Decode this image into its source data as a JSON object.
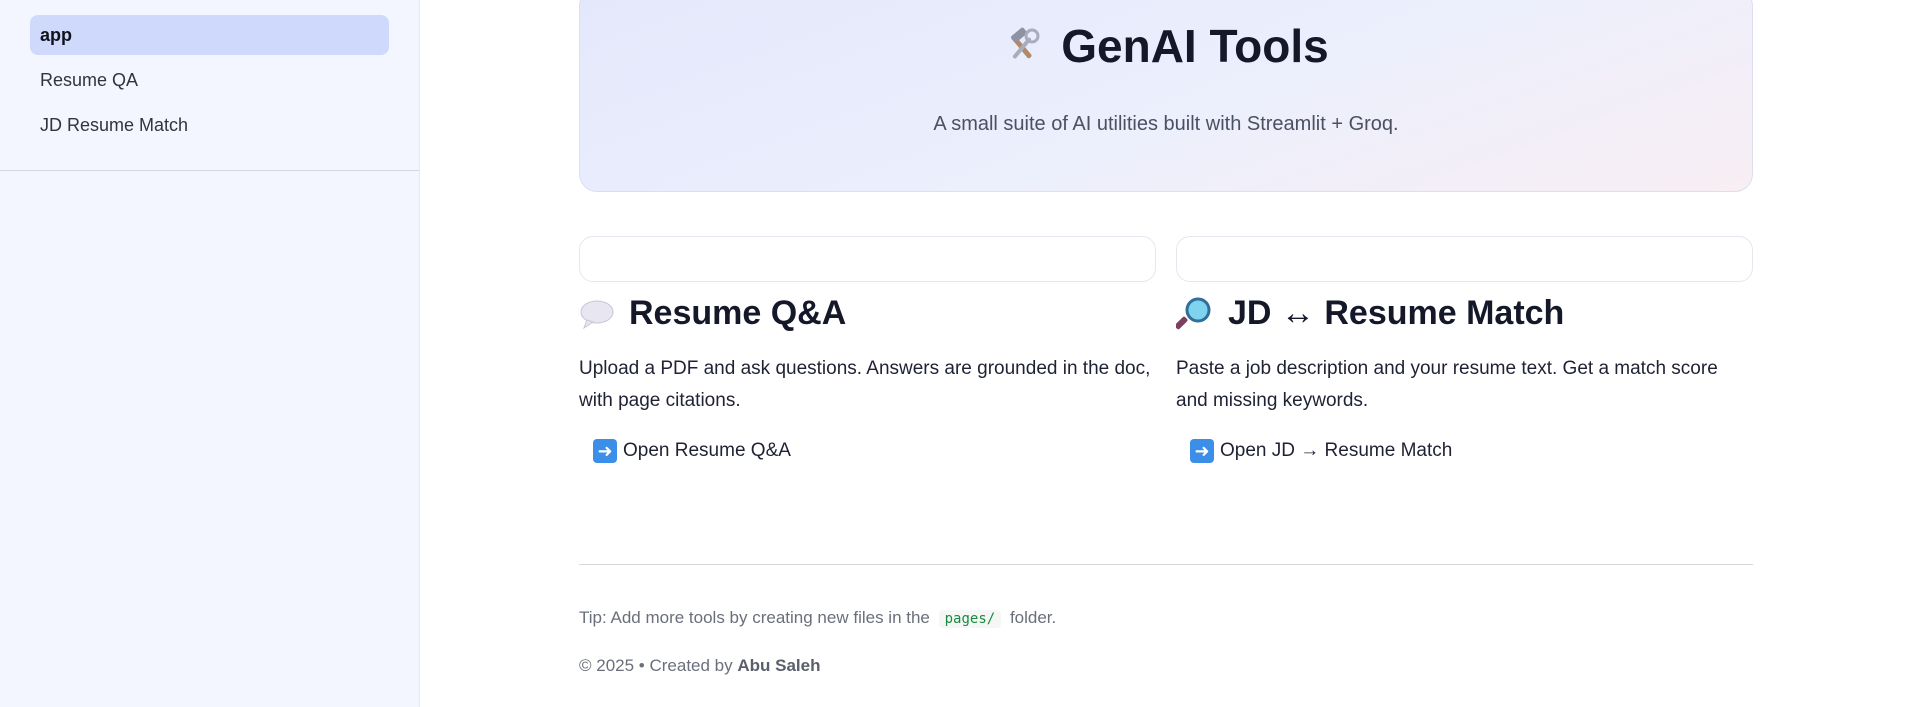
{
  "sidebar": {
    "items": [
      {
        "label": "app",
        "active": true
      },
      {
        "label": "Resume QA",
        "active": false
      },
      {
        "label": "JD Resume Match",
        "active": false
      }
    ]
  },
  "hero": {
    "icon": "hammer-wrench-icon",
    "title": "GenAI Tools",
    "subtitle": "A small suite of AI utilities built with Streamlit + Groq."
  },
  "cards": [
    {
      "icon": "speech-bubble-icon",
      "title": "Resume Q&A",
      "description": "Upload a PDF and ask questions. Answers are grounded in the doc, with page citations.",
      "link_icon": "right-arrow-icon",
      "link_label": "Open Resume Q&A"
    },
    {
      "icon": "magnifying-glass-icon",
      "title": "JD ↔ Resume Match",
      "description": "Paste a job description and your resume text. Get a match score and missing keywords.",
      "link_icon": "right-arrow-icon",
      "link_label": "Open JD → Resume Match"
    }
  ],
  "tip": {
    "before": "Tip: Add more tools by creating new files in the",
    "code": "pages/",
    "after": "folder."
  },
  "footer": {
    "prefix": "© 2025 • Created by",
    "author": "Abu Saleh"
  },
  "colors": {
    "sidebar_bg": "#f3f6fe",
    "active_item_bg": "#cfd9fb",
    "code_text": "#1a8a3c",
    "arrow_box": "#3b8fe8"
  }
}
